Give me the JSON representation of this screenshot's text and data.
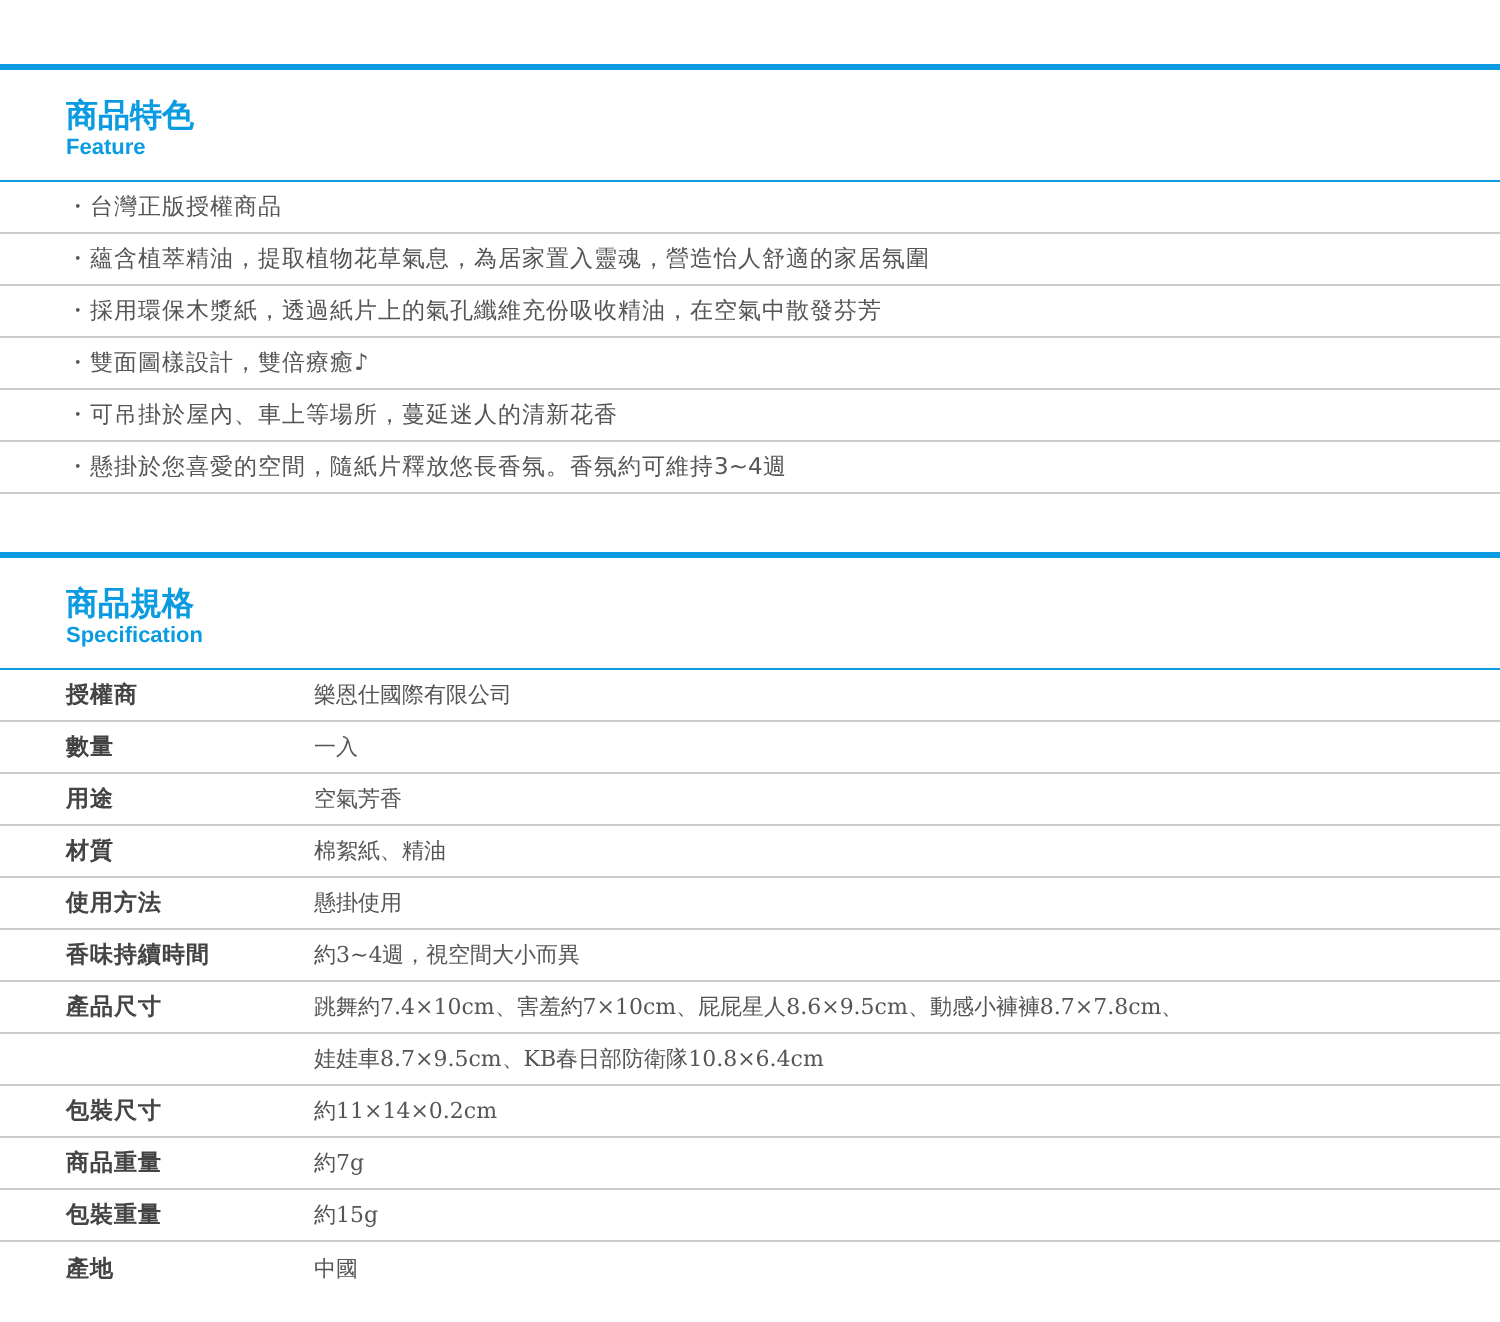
{
  "sections": [
    {
      "title": "商品特色",
      "subtitle": "Feature",
      "kind": "bullets",
      "items": [
        "・台灣正版授權商品",
        "・蘊含植萃精油，提取植物花草氣息，為居家置入靈魂，營造怡人舒適的家居氛圍",
        "・採用環保木漿紙，透過紙片上的氣孔纖維充份吸收精油，在空氣中散發芬芳",
        "・雙面圖樣設計，雙倍療癒♪",
        "・可吊掛於屋內、車上等場所，蔓延迷人的清新花香",
        "・懸掛於您喜愛的空間，隨紙片釋放悠長香氛。香氛約可維持3~4週"
      ]
    },
    {
      "title": "商品規格",
      "subtitle": "Specification",
      "kind": "table",
      "rows": [
        {
          "label": "授權商",
          "value": "樂恩仕國際有限公司"
        },
        {
          "label": "數量",
          "value": "一入"
        },
        {
          "label": "用途",
          "value": "空氣芳香"
        },
        {
          "label": "材質",
          "value": "棉絮紙、精油"
        },
        {
          "label": "使用方法",
          "value": "懸掛使用"
        },
        {
          "label": "香味持續時間",
          "value": "約3~4週，視空間大小而異"
        },
        {
          "label": "產品尺寸",
          "value": "跳舞約7.4×10cm、害羞約7×10cm、屁屁星人8.6×9.5cm、動感小褲褲8.7×7.8cm、"
        },
        {
          "value": "娃娃車8.7×9.5cm、KB春日部防衛隊10.8×6.4cm"
        },
        {
          "label": "包裝尺寸",
          "value": "約11×14×0.2cm"
        },
        {
          "label": "商品重量",
          "value": "約7g"
        },
        {
          "label": "包裝重量",
          "value": "約15g"
        },
        {
          "label": "產地",
          "value": "中國"
        }
      ]
    }
  ]
}
